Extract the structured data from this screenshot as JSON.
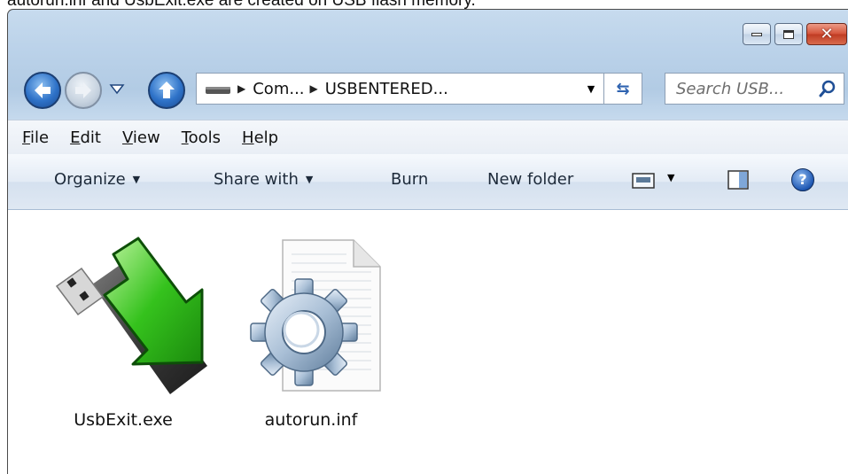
{
  "caption": "autorun.inf and UsbExit.exe are created on USB flash memory.",
  "window": {
    "address": {
      "crumbs": [
        "Com...",
        "USBENTERED..."
      ],
      "refresh_icon": "refresh-icon"
    },
    "search": {
      "placeholder": "Search USB..."
    },
    "menu": [
      {
        "accel": "F",
        "rest": "ile"
      },
      {
        "accel": "E",
        "rest": "dit"
      },
      {
        "accel": "V",
        "rest": "iew"
      },
      {
        "accel": "T",
        "rest": "ools"
      },
      {
        "accel": "H",
        "rest": "elp"
      }
    ],
    "commands": {
      "organize": "Organize",
      "share_with": "Share with",
      "burn": "Burn",
      "new_folder": "New folder"
    },
    "files": [
      {
        "name": "UsbExit.exe",
        "icon": "usb-drive-arrow-icon"
      },
      {
        "name": "autorun.inf",
        "icon": "settings-file-icon"
      }
    ],
    "colors": {
      "accent_green": "#2fb51f",
      "close_red": "#c03c23"
    }
  }
}
